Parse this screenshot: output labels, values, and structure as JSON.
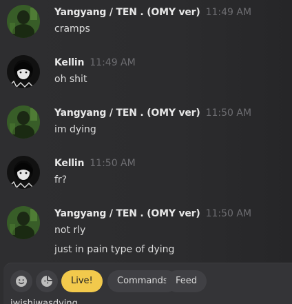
{
  "messages": [
    {
      "author": "Yangyang / TEN . (OMY ver)",
      "time": "11:49 AM",
      "lines": [
        "cramps"
      ],
      "avatar": "green-avatar"
    },
    {
      "author": "Kellin",
      "time": "11:49 AM",
      "lines": [
        "oh shit"
      ],
      "avatar": "bw-avatar"
    },
    {
      "author": "Yangyang / TEN . (OMY ver)",
      "time": "11:50 AM",
      "lines": [
        "im dying"
      ],
      "avatar": "green-avatar"
    },
    {
      "author": "Kellin",
      "time": "11:50 AM",
      "lines": [
        "fr?"
      ],
      "avatar": "bw-avatar"
    },
    {
      "author": "Yangyang / TEN . (OMY ver)",
      "time": "11:50 AM",
      "lines": [
        "not rly",
        "just in pain type of dying"
      ],
      "avatar": "green-avatar"
    }
  ],
  "composer": {
    "live_label": "Live!",
    "commands_label": "Commands",
    "feed_label": "Feed",
    "draft_text": "iwishiwasdying",
    "emoji_icon": "smiley-icon",
    "sticker_icon": "sticker-icon"
  },
  "colors": {
    "background": "#2c2c2e",
    "live_accent": "#f2c94c",
    "timestamp": "#6e6e72"
  }
}
